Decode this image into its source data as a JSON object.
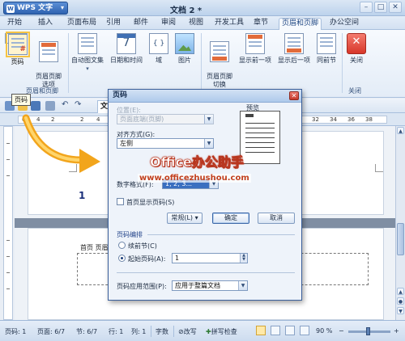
{
  "titlebar": {
    "app_name": "WPS 文字",
    "doc_title": "文档 2 *",
    "controls": [
      "–",
      "□",
      "✕"
    ]
  },
  "menu": {
    "tabs": [
      "开始",
      "插入",
      "页面布局",
      "引用",
      "邮件",
      "审阅",
      "视图",
      "开发工具",
      "章节",
      "页眉和页脚",
      "办公空间"
    ],
    "active": "页眉和页脚"
  },
  "ribbon": {
    "buttons": {
      "page_num": "页码",
      "hf_options": "页眉页脚\n选项",
      "auto_text": "自动图文集",
      "datetime": "日期和时间",
      "field": "域",
      "picture": "图片",
      "switch": "页眉页脚\n切换",
      "show_prev": "显示前一项",
      "show_next": "显示后一项",
      "same_prev": "同前节",
      "close": "关闭"
    },
    "groups": {
      "hf": "页眉和页脚",
      "close": "关闭"
    }
  },
  "tooltip": "页码",
  "doc_tab": "文",
  "ruler": {
    "ticks": [
      "6",
      "4",
      "2",
      "2",
      "4",
      "6",
      "8",
      "10",
      "30",
      "32",
      "34",
      "36",
      "38"
    ]
  },
  "document": {
    "page1_number": "1",
    "page2_header_label": "首页 页眉"
  },
  "dialog": {
    "title": "页码",
    "position_label": "位置(E):",
    "position_value": "页面底端(页脚)",
    "align_label": "对齐方式(G):",
    "align_value": "左侧",
    "preview_label": "预览",
    "num_format_label": "数字格式(F):",
    "num_format_value": "1, 2, 3...",
    "first_page_check": "首页显示页码(S)",
    "btn_general": "常规(L) ▾",
    "btn_ok": "确定",
    "btn_cancel": "取消",
    "section_numbering": "页码编排",
    "radio_continue": "续前节(C)",
    "radio_start": "起始页码(A):",
    "start_value": "1",
    "apply_label": "页码应用范围(P):",
    "apply_value": "应用于整篇文档"
  },
  "watermark": {
    "line1": "Office办公助手",
    "line2": "www.officezhushou.com"
  },
  "statusbar": {
    "page": "页码: 1",
    "pages": "页面: 6/7",
    "section": "节: 6/7",
    "row": "行: 1",
    "col": "列: 1",
    "chars": "字数",
    "rev": "改写",
    "spell": "拼写检查",
    "zoom": "90 %"
  }
}
